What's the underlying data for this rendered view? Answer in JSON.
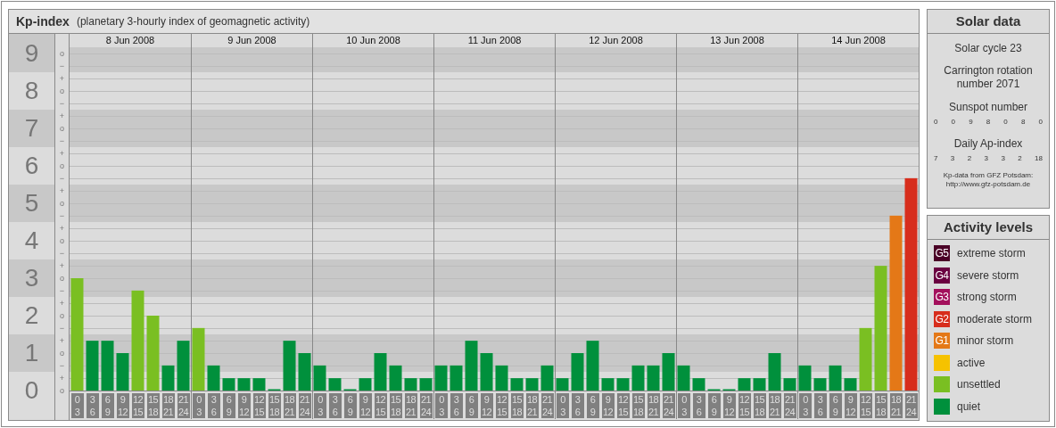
{
  "kp_panel": {
    "title": "Kp-index",
    "subtitle": "(planetary 3-hourly index of geomagnetic activity)",
    "days": [
      "8 Jun 2008",
      "9 Jun 2008",
      "10 Jun 2008",
      "11 Jun 2008",
      "12 Jun 2008",
      "13 Jun 2008",
      "14 Jun 2008"
    ],
    "minor_ticks": [
      "o",
      "−",
      "+",
      "o",
      "−",
      "+",
      "o",
      "−",
      "+",
      "o",
      "−",
      "+",
      "o",
      "−",
      "+",
      "o",
      "−",
      "+",
      "o",
      "−",
      "+",
      "o",
      "−",
      "+",
      "o",
      "−",
      "+",
      "o"
    ],
    "chart_data": {
      "type": "bar",
      "stacked": true,
      "ylim": [
        0,
        9.1667
      ],
      "grid": true,
      "yticks": [
        {
          "value": 9,
          "label": "9"
        },
        {
          "value": 8,
          "label": "8"
        },
        {
          "value": 7,
          "label": "7"
        },
        {
          "value": 6,
          "label": "6"
        },
        {
          "value": 5,
          "label": "5"
        },
        {
          "value": 4,
          "label": "4"
        },
        {
          "value": 3,
          "label": "3"
        },
        {
          "value": 2,
          "label": "2"
        },
        {
          "value": 1,
          "label": "1"
        },
        {
          "value": 0,
          "label": "0"
        }
      ],
      "categories": [
        "0\n3",
        "3\n6",
        "6\n9",
        "9\n12",
        "12\n15",
        "15\n18",
        "18\n21",
        "21\n24",
        "0\n3",
        "3\n6",
        "6\n9",
        "9\n12",
        "12\n15",
        "15\n18",
        "18\n21",
        "21\n24",
        "0\n3",
        "3\n6",
        "6\n9",
        "9\n12",
        "12\n15",
        "15\n18",
        "18\n21",
        "21\n24",
        "0\n3",
        "3\n6",
        "6\n9",
        "9\n12",
        "12\n15",
        "15\n18",
        "18\n21",
        "21\n24",
        "0\n3",
        "3\n6",
        "6\n9",
        "9\n12",
        "12\n15",
        "15\n18",
        "18\n21",
        "21\n24",
        "0\n3",
        "3\n6",
        "6\n9",
        "9\n12",
        "12\n15",
        "15\n18",
        "18\n21",
        "21\n24",
        "0\n3",
        "3\n6",
        "6\n9",
        "9\n12",
        "12\n15",
        "15\n18",
        "18\n21",
        "21\n24"
      ],
      "series": [
        {
          "color": "#00903c",
          "values": [
            null,
            1.33,
            1.33,
            1,
            null,
            null,
            0.67,
            1.33,
            null,
            0.67,
            0.33,
            0.33,
            0.33,
            0,
            1.33,
            1,
            0.67,
            0.33,
            0,
            0.33,
            1,
            0.67,
            0.33,
            0.33,
            0.67,
            0.67,
            1.33,
            1,
            0.67,
            0.33,
            0.33,
            0.67,
            0.33,
            1,
            1.33,
            0.33,
            0.33,
            0.67,
            0.67,
            1,
            0.67,
            0.33,
            0,
            0,
            0.33,
            0.33,
            1,
            0.33,
            0.67,
            0.33,
            0.67,
            0.33,
            null,
            null,
            null,
            null
          ]
        },
        {
          "color": "#7abf22",
          "values": [
            3,
            null,
            null,
            null,
            2.67,
            2,
            null,
            null,
            1.67,
            null,
            null,
            null,
            null,
            null,
            null,
            null,
            null,
            null,
            null,
            null,
            null,
            null,
            null,
            null,
            null,
            null,
            null,
            null,
            null,
            null,
            null,
            null,
            null,
            null,
            null,
            null,
            null,
            null,
            null,
            null,
            null,
            null,
            null,
            null,
            null,
            null,
            null,
            null,
            null,
            null,
            null,
            null,
            1.67,
            3.33,
            null,
            null
          ]
        },
        {
          "color": "#e47817",
          "values": [
            null,
            null,
            null,
            null,
            null,
            null,
            null,
            null,
            null,
            null,
            null,
            null,
            null,
            null,
            null,
            null,
            null,
            null,
            null,
            null,
            null,
            null,
            null,
            null,
            null,
            null,
            null,
            null,
            null,
            null,
            null,
            null,
            null,
            null,
            null,
            null,
            null,
            null,
            null,
            null,
            null,
            null,
            null,
            null,
            null,
            null,
            null,
            null,
            null,
            null,
            null,
            null,
            null,
            null,
            4.67,
            null
          ]
        },
        {
          "color": "#d72d1c",
          "values": [
            null,
            null,
            null,
            null,
            null,
            null,
            null,
            null,
            null,
            null,
            null,
            null,
            null,
            null,
            null,
            null,
            null,
            null,
            null,
            null,
            null,
            null,
            null,
            null,
            null,
            null,
            null,
            null,
            null,
            null,
            null,
            null,
            null,
            null,
            null,
            null,
            null,
            null,
            null,
            null,
            null,
            null,
            null,
            null,
            null,
            null,
            null,
            null,
            null,
            null,
            null,
            null,
            null,
            null,
            null,
            5.67
          ]
        }
      ]
    }
  },
  "solar_data": {
    "title": "Solar data",
    "cycle": "Solar cycle 23",
    "rotation": "Carrington rotation number 2071",
    "sunspot_label": "Sunspot number",
    "sunspot_values": [
      "0",
      "0",
      "9",
      "8",
      "0",
      "8",
      "0"
    ],
    "ap_label": "Daily Ap-index",
    "ap_values": [
      "7",
      "3",
      "2",
      "3",
      "3",
      "2",
      "18"
    ],
    "source": "Kp-data from GFZ Potsdam:",
    "source_url": "http://www.gfz-potsdam.de"
  },
  "activity_levels": {
    "title": "Activity levels",
    "items": [
      {
        "badge": "G5",
        "label": "extreme storm",
        "color": "#4a0026"
      },
      {
        "badge": "G4",
        "label": "severe storm",
        "color": "#6a0040"
      },
      {
        "badge": "G3",
        "label": "strong storm",
        "color": "#a3105c"
      },
      {
        "badge": "G2",
        "label": "moderate storm",
        "color": "#d72d1c"
      },
      {
        "badge": "G1",
        "label": "minor storm",
        "color": "#e47817"
      },
      {
        "label": "active",
        "color": "#f6c200"
      },
      {
        "label": "unsettled",
        "color": "#7abf22"
      },
      {
        "label": "quiet",
        "color": "#00903c"
      }
    ]
  }
}
